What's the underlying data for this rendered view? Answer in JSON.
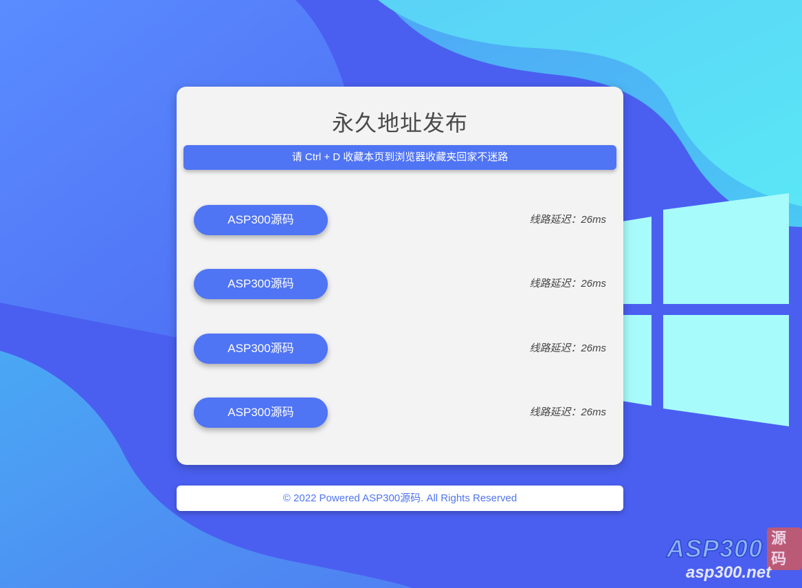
{
  "page": {
    "title": "永久地址发布",
    "notice": "请 Ctrl + D 收藏本页到浏览器收藏夹回家不迷路"
  },
  "lines": [
    {
      "label": "ASP300源码",
      "latency": "线路延迟：26ms"
    },
    {
      "label": "ASP300源码",
      "latency": "线路延迟：26ms"
    },
    {
      "label": "ASP300源码",
      "latency": "线路延迟：26ms"
    },
    {
      "label": "ASP300源码",
      "latency": "线路延迟：26ms"
    }
  ],
  "footer": {
    "text": "© 2022 Powered ASP300源码. All Rights Reserved"
  },
  "watermark": {
    "brand": "ASP300",
    "badge": "源码",
    "url": "asp300.net"
  },
  "colors": {
    "background": "#4a63f2",
    "accent": "#4f74f4",
    "card": "#f3f3f3",
    "wave_light": "#5ad8f5",
    "windows_logo": "#a8fbfb"
  },
  "icons": {
    "background_logo": "windows-logo-icon"
  }
}
